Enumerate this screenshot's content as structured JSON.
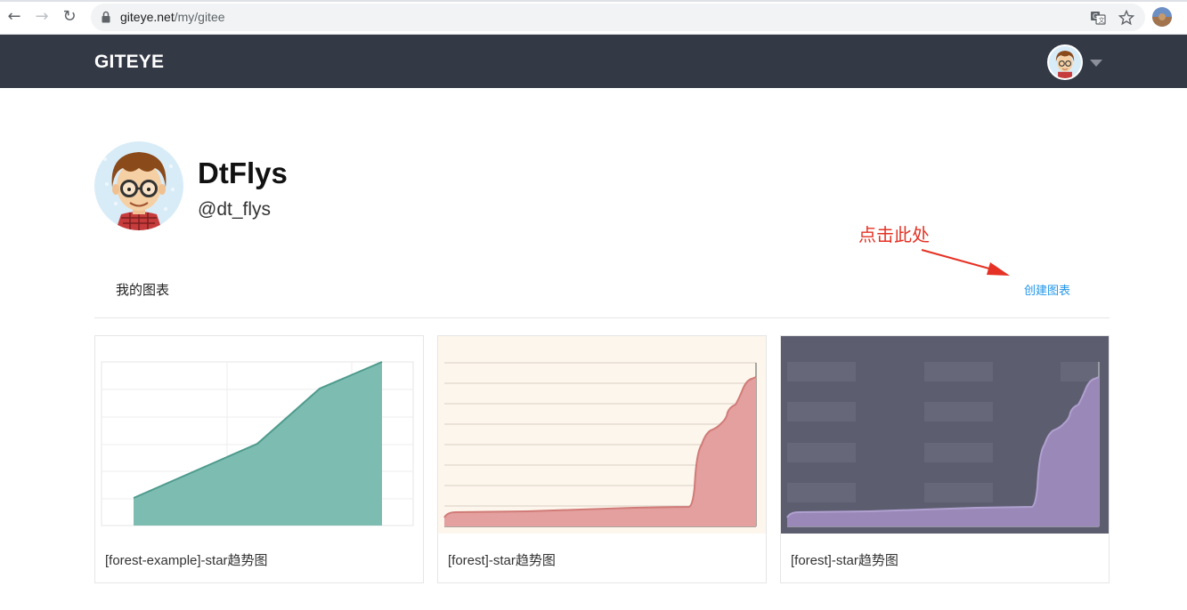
{
  "browser": {
    "url_host": "giteye.net",
    "url_path": "/my/gitee"
  },
  "header": {
    "brand": "GITEYE"
  },
  "profile": {
    "name": "DtFlys",
    "handle": "@dt_flys"
  },
  "annotation": {
    "text": "点击此处"
  },
  "tabs": {
    "my_charts": "我的图表",
    "create_chart": "创建图表"
  },
  "cards": [
    {
      "caption": "[forest-example]-star趋势图",
      "theme": "teal"
    },
    {
      "caption": "[forest]-star趋势图",
      "theme": "red"
    },
    {
      "caption": "[forest]-star趋势图",
      "theme": "purple"
    }
  ],
  "colors": {
    "header_bg": "#343946",
    "link": "#2196e8",
    "annotation": "#e53224",
    "teal_fill": "#7dbcb0",
    "red_fill": "#e3a09e",
    "purple_fill": "#9a89b8"
  }
}
